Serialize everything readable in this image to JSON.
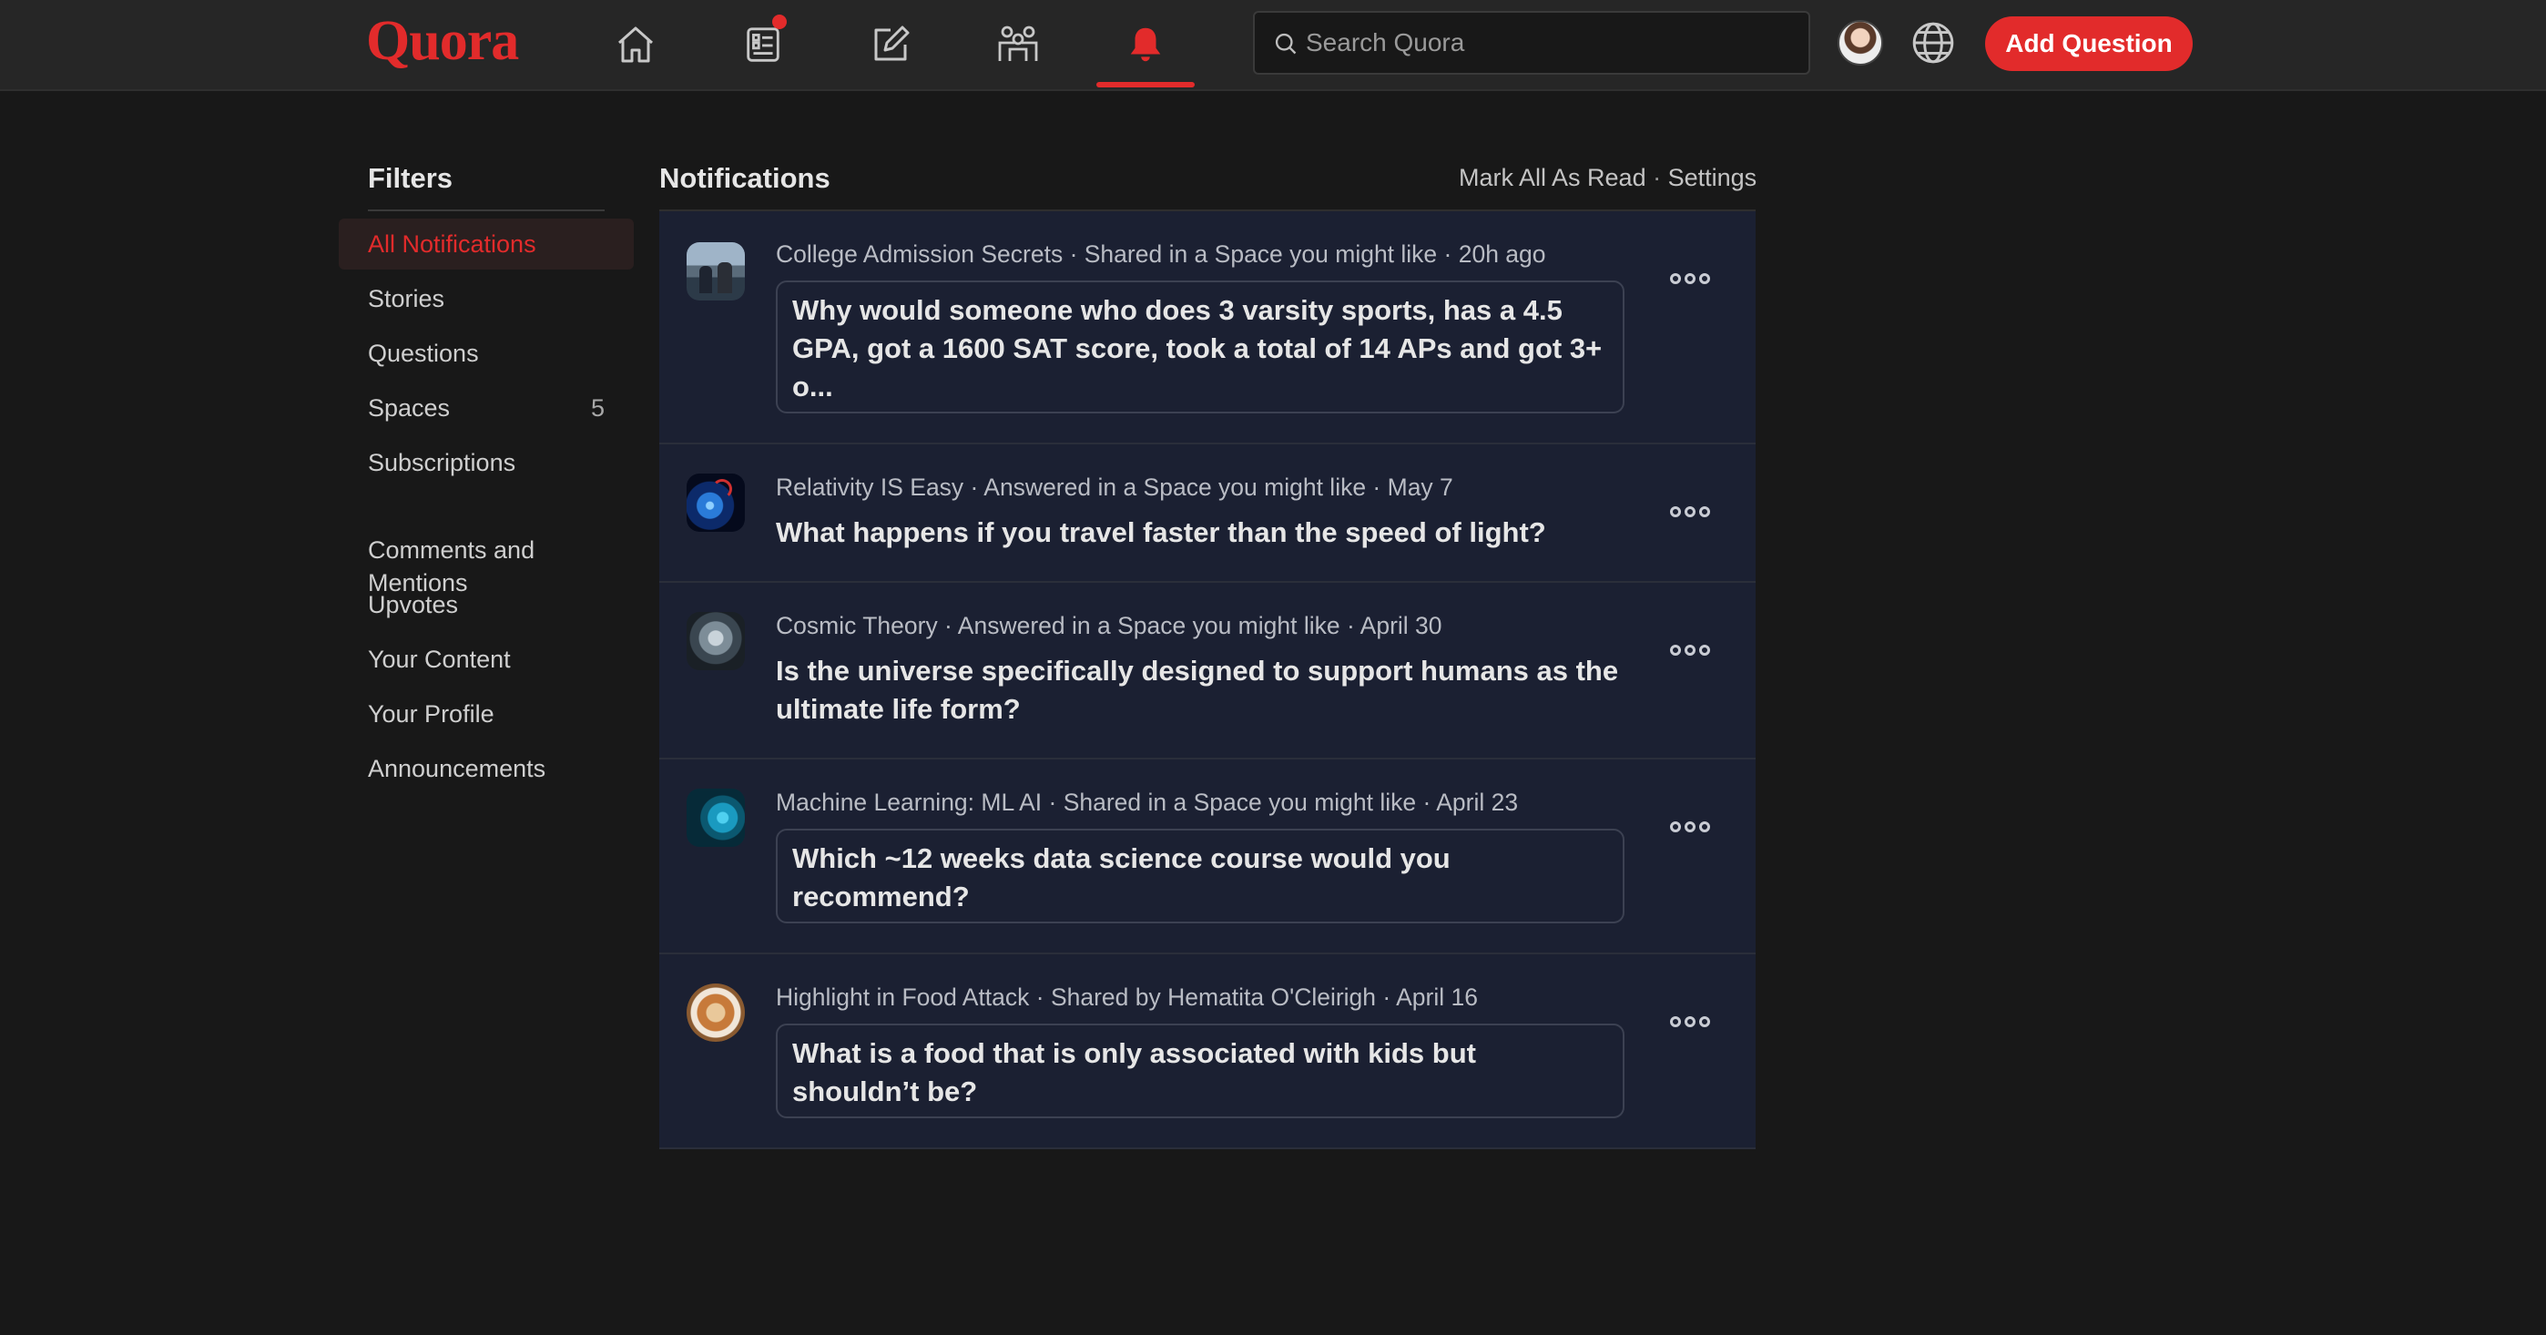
{
  "brand": {
    "logo_text": "Quora",
    "accent": "#e22b2b"
  },
  "header": {
    "nav": [
      {
        "name": "home",
        "icon": "home-icon",
        "active": false
      },
      {
        "name": "following",
        "icon": "list-icon",
        "active": false,
        "has_badge": true
      },
      {
        "name": "answer",
        "icon": "edit-icon",
        "active": false
      },
      {
        "name": "spaces",
        "icon": "people-icon",
        "active": false
      },
      {
        "name": "notifications",
        "icon": "bell-icon",
        "active": true
      }
    ],
    "search_placeholder": "Search Quora",
    "add_question_label": "Add Question"
  },
  "sidebar": {
    "title": "Filters",
    "items": [
      {
        "label": "All Notifications",
        "active": true,
        "count": ""
      },
      {
        "label": "Stories",
        "count": ""
      },
      {
        "label": "Questions",
        "count": ""
      },
      {
        "label": "Spaces",
        "count": "5"
      },
      {
        "label": "Subscriptions",
        "count": ""
      },
      {
        "label": "Comments and\nMentions",
        "count": ""
      },
      {
        "label": "Upvotes",
        "count": ""
      },
      {
        "label": "Your Content",
        "count": ""
      },
      {
        "label": "Your Profile",
        "count": ""
      },
      {
        "label": "Announcements",
        "count": ""
      }
    ]
  },
  "main": {
    "title": "Notifications",
    "mark_all_label": "Mark All As Read",
    "separator": " · ",
    "settings_label": "Settings",
    "notifications": [
      {
        "meta": "College Admission Secrets · Shared in a Space you might like · 20h ago",
        "question": "Why would someone who does 3 varsity sports, has a 4.5 GPA, got a 1600 SAT score, took a total of 14 APs and got 3+ o...",
        "boxed": true
      },
      {
        "meta": "Relativity IS Easy · Answered in a Space you might like · May 7",
        "question": "What happens if you travel faster than the speed of light?",
        "boxed": false
      },
      {
        "meta": "Cosmic Theory · Answered in a Space you might like · April 30",
        "question": "Is the universe specifically designed to support humans as the ultimate life form?",
        "boxed": false
      },
      {
        "meta": "Machine Learning: ML AI · Shared in a Space you might like · April 23",
        "question": "Which ~12 weeks data science course would you recommend?",
        "boxed": true
      },
      {
        "meta": "Highlight in Food Attack · Shared by Hematita O'Cleirigh · April 16",
        "question": "What is a food that is only associated with kids but shouldn’t be?",
        "boxed": true
      }
    ]
  }
}
